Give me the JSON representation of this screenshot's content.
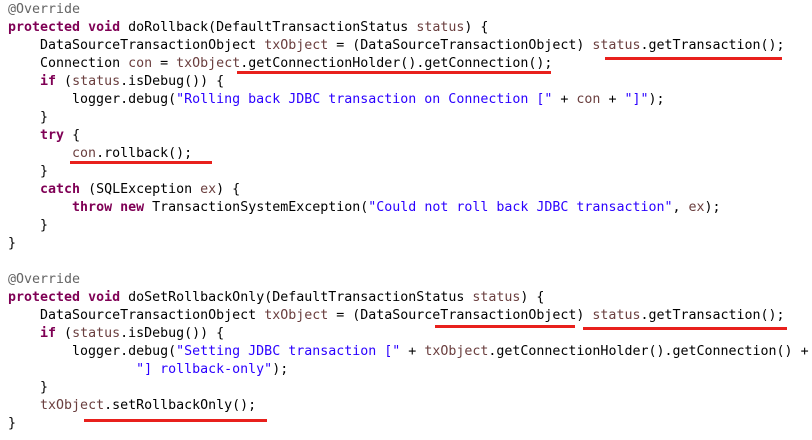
{
  "code": {
    "l1": [
      "@Override"
    ],
    "l2": [
      "protected",
      " ",
      "void",
      " doRollback(DefaultTransactionStatus ",
      "status",
      ") {"
    ],
    "l3": [
      "    DataSourceTransactionObject ",
      "txObject",
      " = (DataSourceTransactionObject) ",
      "status",
      ".getTransaction();"
    ],
    "l4": [
      "    Connection ",
      "con",
      " = ",
      "txObject",
      ".getConnectionHolder().getConnection();"
    ],
    "l5": [
      "    ",
      "if",
      " (",
      "status",
      ".isDebug()) {"
    ],
    "l6": [
      "        logger.debug(",
      "\"Rolling back JDBC transaction on Connection [\"",
      " + ",
      "con",
      " + ",
      "\"]\"",
      ");"
    ],
    "l7": [
      "    }"
    ],
    "l8": [
      "    ",
      "try",
      " {"
    ],
    "l9": [
      "        ",
      "con",
      ".rollback();"
    ],
    "l10": [
      "    }"
    ],
    "l11": [
      "    ",
      "catch",
      " (SQLException ",
      "ex",
      ") {"
    ],
    "l12": [
      "        ",
      "throw",
      " ",
      "new",
      " TransactionSystemException(",
      "\"Could not roll back JDBC transaction\"",
      ", ",
      "ex",
      ");"
    ],
    "l13": [
      "    }"
    ],
    "l14": [
      "}"
    ],
    "l16": [
      "@Override"
    ],
    "l17": [
      "protected",
      " ",
      "void",
      " doSetRollbackOnly(DefaultTransactionStatus ",
      "status",
      ") {"
    ],
    "l18": [
      "    DataSourceTransactionObject ",
      "txObject",
      " = (DataSourceTransactionObject) ",
      "status",
      ".getTransaction();"
    ],
    "l19": [
      "    ",
      "if",
      " (",
      "status",
      ".isDebug()) {"
    ],
    "l20": [
      "        logger.debug(",
      "\"Setting JDBC transaction [\"",
      " + ",
      "txObject",
      ".getConnectionHolder().getConnection() +"
    ],
    "l21": [
      "                ",
      "\"] rollback-only\"",
      ");"
    ],
    "l22": [
      "    }"
    ],
    "l23": [
      "    ",
      "txObject",
      ".setRollbackOnly();"
    ],
    "l24": [
      "}"
    ]
  },
  "colors": {
    "keyword": "#7f0055",
    "annotation": "#646464",
    "string": "#2a00ff",
    "variable": "#6a3e3e",
    "underline": "#e8201c"
  }
}
